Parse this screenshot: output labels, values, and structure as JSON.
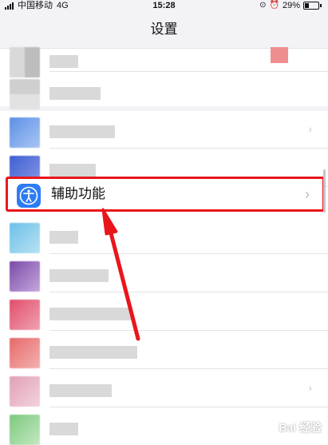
{
  "status_bar": {
    "carrier": "中国移动",
    "network": "4G",
    "time": "15:28",
    "battery_percent": "29%",
    "battery_level": 0.29
  },
  "nav_bar": {
    "title": "设置"
  },
  "highlighted_item": {
    "label": "辅助功能",
    "icon": "accessibility-icon",
    "chevron": "›"
  },
  "colors": {
    "highlight": "#e8161b",
    "accessibility_icon_bg": "#2d7cf6",
    "background": "#f2f2f7"
  },
  "watermark": {
    "text": "Bai 经验"
  }
}
